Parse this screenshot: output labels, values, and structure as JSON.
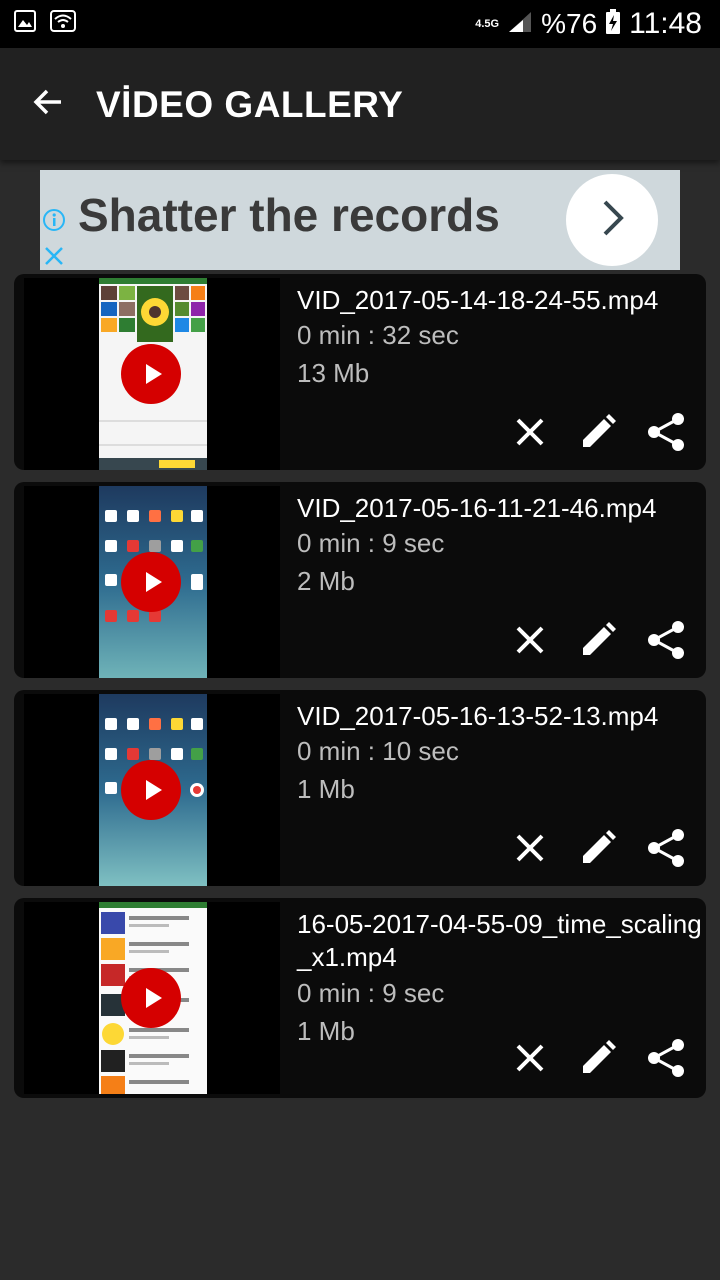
{
  "status_bar": {
    "network": "4.5G",
    "battery": "%76",
    "time": "11:48"
  },
  "app_bar": {
    "title": "VİDEO GALLERY"
  },
  "ad": {
    "text": "Shatter the records"
  },
  "videos": [
    {
      "name": "VID_2017-05-14-18-24-55.mp4",
      "duration": "0 min : 32 sec",
      "size": "13 Mb"
    },
    {
      "name": "VID_2017-05-16-11-21-46.mp4",
      "duration": "0 min : 9 sec",
      "size": "2 Mb"
    },
    {
      "name": "VID_2017-05-16-13-52-13.mp4",
      "duration": "0 min : 10 sec",
      "size": "1 Mb"
    },
    {
      "name": "16-05-2017-04-55-09_time_scaling_x1.mp4",
      "duration": "0 min : 9 sec",
      "size": "1 Mb"
    }
  ],
  "icons": {
    "delete": "close-icon",
    "rename": "pencil-icon",
    "share": "share-icon",
    "back": "arrow-back-icon"
  }
}
